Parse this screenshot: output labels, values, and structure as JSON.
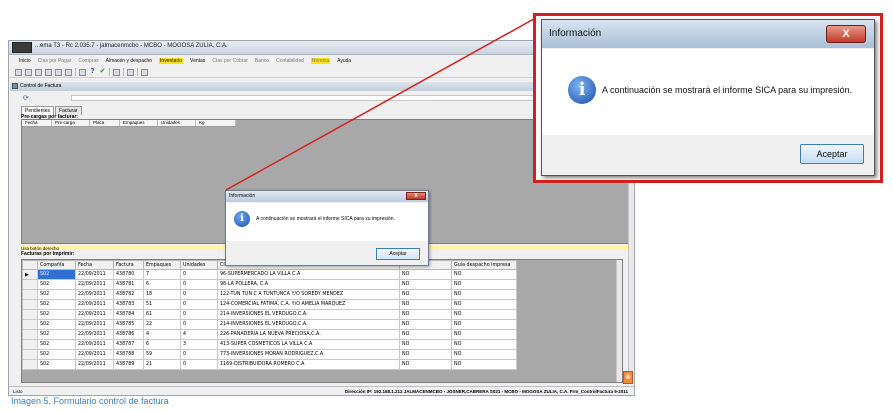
{
  "app": {
    "title": "...ema T3 - Rc 2.035.7 - jalmacenmcbo - MCBO - MOGOSA ZULIA, C.A.",
    "menu": [
      {
        "label": "Inicio",
        "disabled": false,
        "highlight": false
      },
      {
        "label": "Ctas por Pagar",
        "disabled": true,
        "highlight": false
      },
      {
        "label": "Compras",
        "disabled": true,
        "highlight": false
      },
      {
        "label": "Almacén y despacho",
        "disabled": false,
        "highlight": false
      },
      {
        "label": "Inventario",
        "disabled": false,
        "highlight": true
      },
      {
        "label": "Ventas",
        "disabled": false,
        "highlight": false
      },
      {
        "label": "Ctas por Cobrar",
        "disabled": true,
        "highlight": false
      },
      {
        "label": "Banco",
        "disabled": true,
        "highlight": false
      },
      {
        "label": "Contabilidad",
        "disabled": true,
        "highlight": false
      },
      {
        "label": "Nómina",
        "disabled": true,
        "highlight": true
      },
      {
        "label": "Ayuda",
        "disabled": false,
        "highlight": false
      }
    ],
    "toolbar_help_glyph": "?",
    "toolbar_check_glyph": "✔"
  },
  "form": {
    "title": "Control de Factura",
    "tabs": [
      "Pendientes",
      "Facturar"
    ],
    "precargas_label": "Pre-cargas por facturar:",
    "precargas_columns": [
      "Fecha",
      "Pre-carga",
      "Placa",
      "Empaques",
      "Unidades",
      "Kg"
    ],
    "hint": "Usa botón derecho",
    "facturas_label": "Facturas por imprimir:",
    "columns": [
      "",
      "Compañía",
      "Fecha",
      "Factura",
      "Empaques",
      "Unidades",
      "Cli...",
      "...resa",
      "Guía despacho impresa"
    ],
    "rows": [
      [
        "▶",
        "S02",
        "22/09/2011",
        "438780",
        "7",
        "0",
        "96-SUPERMERCADO LA VILLA C.A",
        "NO",
        "NO"
      ],
      [
        "",
        "S02",
        "22/09/2011",
        "438781",
        "6",
        "0",
        "98-LA POLLERA, C.A",
        "NO",
        "NO"
      ],
      [
        "",
        "S02",
        "22/09/2011",
        "438782",
        "18",
        "0",
        "122-TUN TUN C A TUNTUNCA Y/O SOREDY MENDEZ",
        "NO",
        "NO"
      ],
      [
        "",
        "S02",
        "22/09/2011",
        "438783",
        "51",
        "0",
        "124-COMERCIAL FATIMA, C.A. Y/O AMELIA MARQUEZ",
        "NO",
        "NO"
      ],
      [
        "",
        "S02",
        "22/09/2011",
        "438784",
        "61",
        "0",
        "214-INVERSIONES EL VERDUGO,C.A.",
        "NO",
        "NO"
      ],
      [
        "",
        "S02",
        "22/09/2011",
        "438785",
        "22",
        "0",
        "214-INVERSIONES EL VERDUGO,C.A.",
        "NO",
        "NO"
      ],
      [
        "",
        "S02",
        "22/09/2011",
        "438786",
        "4",
        "4",
        "226-PANADERIA LA NUEVA PRECIOSA,C.A.",
        "NO",
        "NO"
      ],
      [
        "",
        "S02",
        "22/09/2011",
        "438787",
        "6",
        "3",
        "413-SUPER COSMETICOS LA VILLA C.A",
        "NO",
        "NO"
      ],
      [
        "",
        "S02",
        "22/09/2011",
        "438788",
        "59",
        "0",
        "773-INVERSIONES MORAN RODRIGUEZ,C.A",
        "NO",
        "NO"
      ],
      [
        "",
        "S02",
        "22/09/2011",
        "438789",
        "21",
        "0",
        "1169-DISTRIBUIDORA ROMERO C.A",
        "NO",
        "NO"
      ]
    ]
  },
  "status": {
    "left": "Listo",
    "right": "Dirección IP: 192.168.1.212   JALMACENMCBO - JOSNER,CABRERA   S021 - MCBO - MOGOSA ZULIA, C.A.   Frm_ControlFactura   9-2011"
  },
  "dialog": {
    "title": "Información",
    "close_glyph": "X",
    "info_glyph": "i",
    "message": "A continuación se mostrará el informe SICA para su impresión.",
    "ok_label": "Aceptar"
  },
  "caption": "Imagen 5. Formulario control de factura",
  "colors": {
    "callout": "#d42020",
    "selection": "#2f6fd6",
    "highlight": "#f6e11b",
    "caption": "#3a7fc1"
  }
}
